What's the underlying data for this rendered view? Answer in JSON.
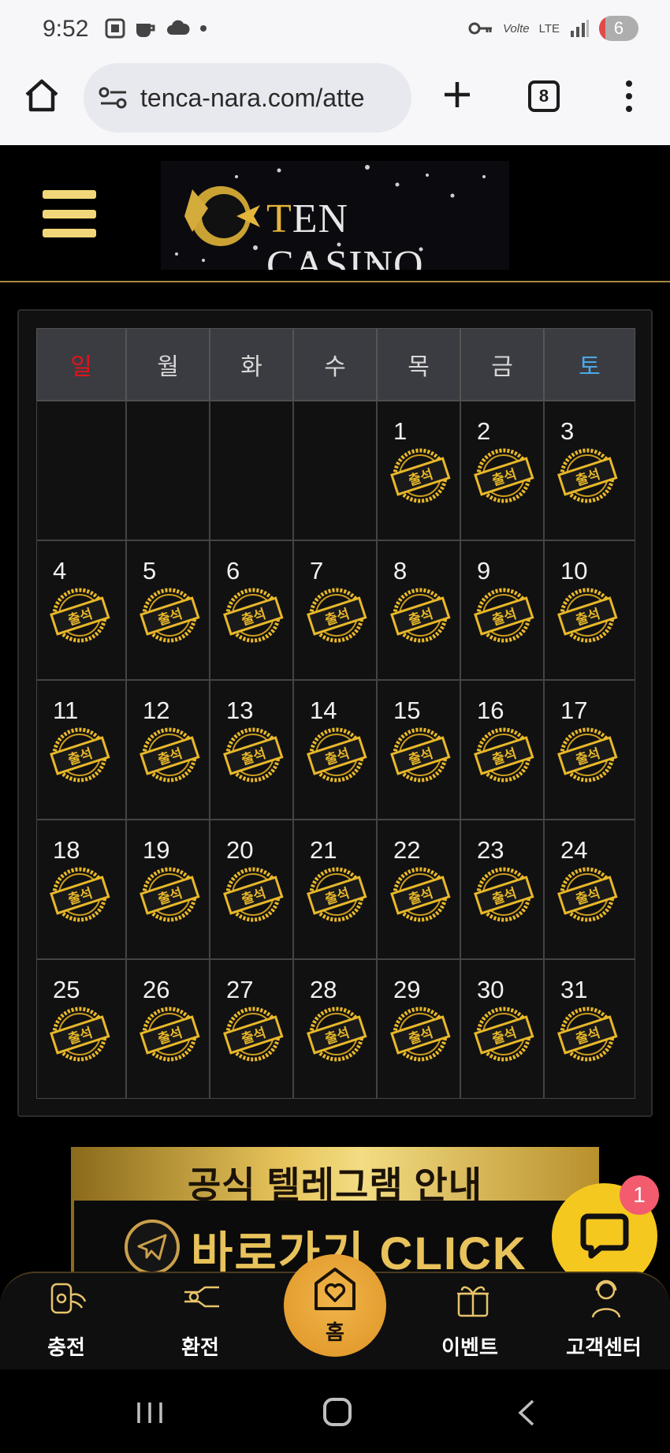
{
  "status_bar": {
    "time": "9:52",
    "network": "LTE",
    "volte": "Volte",
    "battery": "6"
  },
  "browser": {
    "url": "tenca-nara.com/atte",
    "tab_count": "8"
  },
  "site": {
    "logo_text_accent": "T",
    "logo_text": "EN CASINO"
  },
  "calendar": {
    "weekdays": [
      {
        "label": "일",
        "color": "#e0141b"
      },
      {
        "label": "월",
        "color": "#d8d8d8"
      },
      {
        "label": "화",
        "color": "#d8d8d8"
      },
      {
        "label": "수",
        "color": "#d8d8d8"
      },
      {
        "label": "목",
        "color": "#d8d8d8"
      },
      {
        "label": "금",
        "color": "#d8d8d8"
      },
      {
        "label": "토",
        "color": "#4aa8e8"
      }
    ],
    "weeks": [
      [
        "",
        "",
        "",
        "",
        "1",
        "2",
        "3"
      ],
      [
        "4",
        "5",
        "6",
        "7",
        "8",
        "9",
        "10"
      ],
      [
        "11",
        "12",
        "13",
        "14",
        "15",
        "16",
        "17"
      ],
      [
        "18",
        "19",
        "20",
        "21",
        "22",
        "23",
        "24"
      ],
      [
        "25",
        "26",
        "27",
        "28",
        "29",
        "30",
        "31"
      ]
    ],
    "stamp_label": "출석"
  },
  "banner": {
    "title": "공식 텔레그램 안내",
    "cta": "바로가기 CLICK"
  },
  "chat": {
    "badge": "1"
  },
  "bottom_nav": {
    "charge": "충전",
    "exchange": "환전",
    "home": "홈",
    "event": "이벤트",
    "support": "고객센터"
  },
  "colors": {
    "gold": "#e3b53a",
    "chat": "#f5c820",
    "home_button": "#e29a2c"
  }
}
